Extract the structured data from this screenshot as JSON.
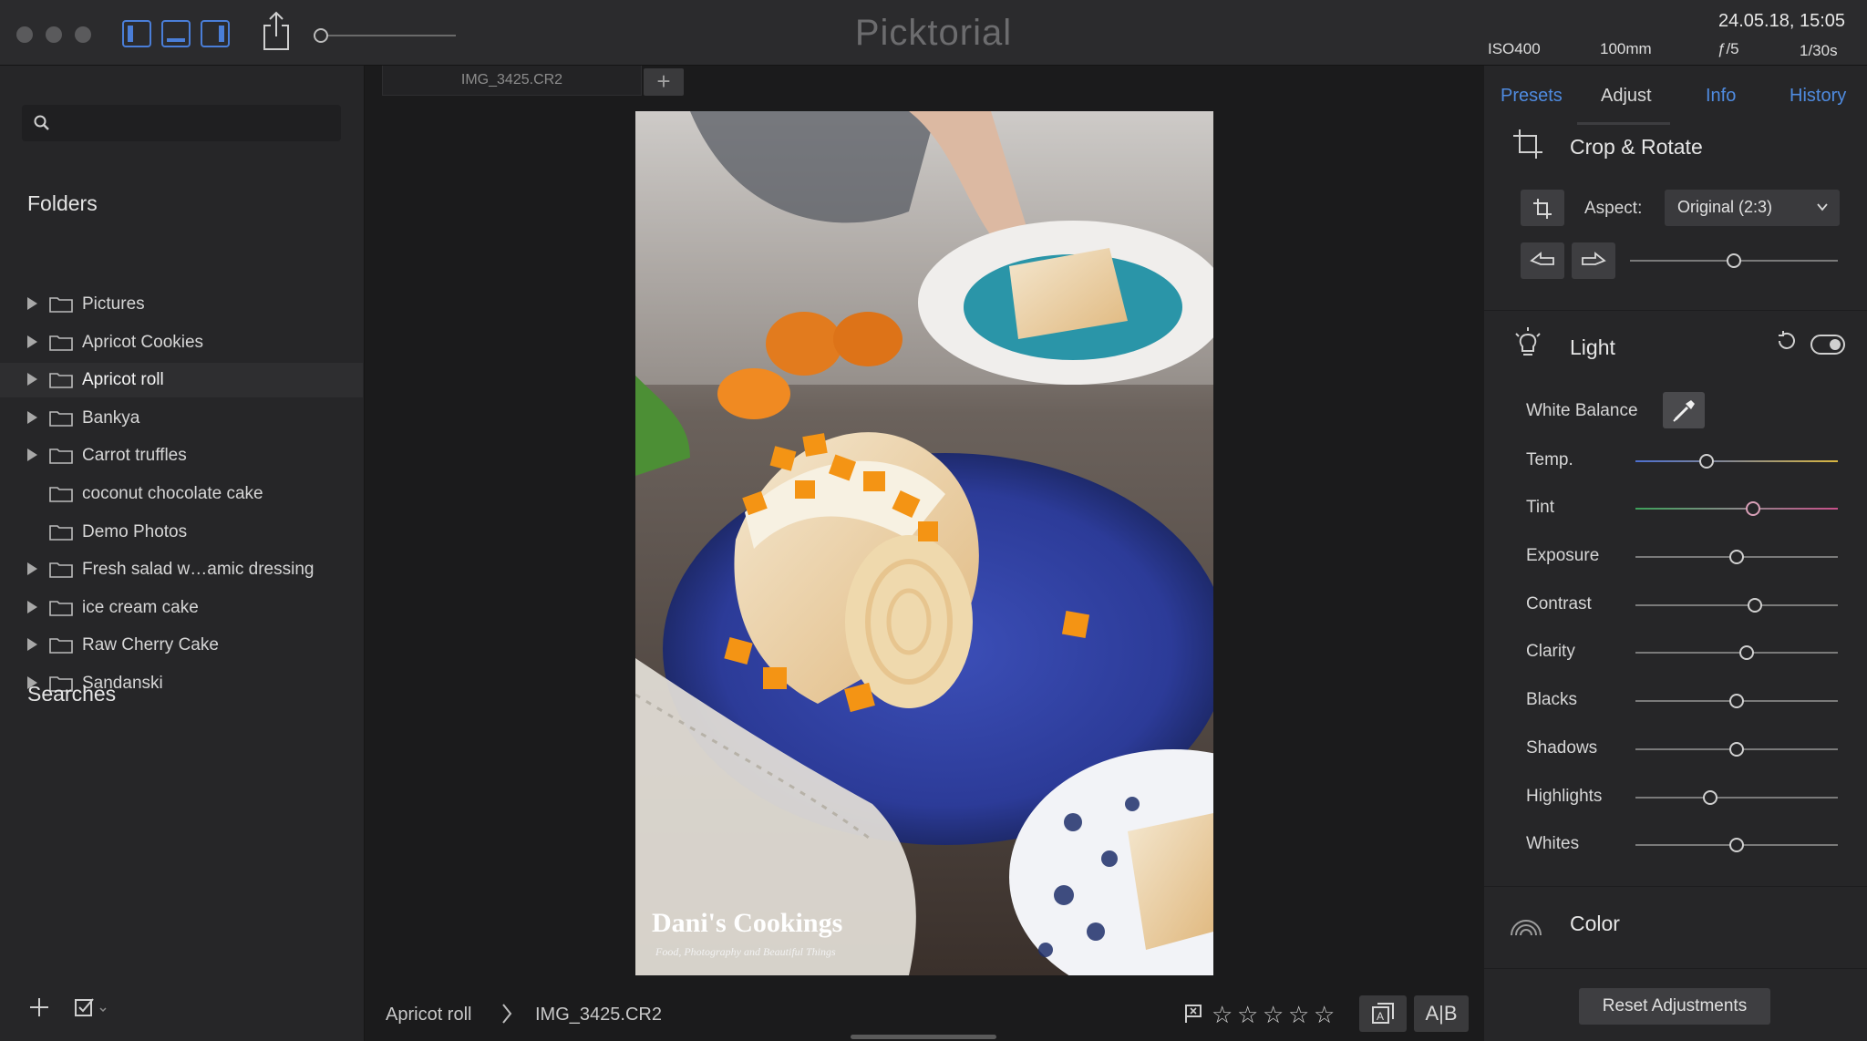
{
  "app": {
    "title": "Picktorial"
  },
  "titlebar": {
    "iso": "ISO400",
    "focal": "100mm",
    "aperture": "ƒ/5",
    "shutter": "1/30s",
    "datetime": "24.05.18, 15:05"
  },
  "sidebar": {
    "search_placeholder": "",
    "folders_title": "Folders",
    "searches_title": "Searches",
    "folders": [
      {
        "label": "Pictures",
        "expandable": true
      },
      {
        "label": "Apricot Cookies",
        "expandable": true
      },
      {
        "label": "Apricot roll",
        "expandable": true,
        "selected": true
      },
      {
        "label": "Bankya",
        "expandable": true
      },
      {
        "label": "Carrot truffles",
        "expandable": true
      },
      {
        "label": "coconut chocolate cake",
        "expandable": false
      },
      {
        "label": "Demo Photos",
        "expandable": false
      },
      {
        "label": "Fresh salad w…amic dressing",
        "expandable": true
      },
      {
        "label": "ice cream cake",
        "expandable": true
      },
      {
        "label": "Raw Cherry Cake",
        "expandable": true
      },
      {
        "label": "Sandanski",
        "expandable": true
      }
    ]
  },
  "viewer": {
    "tab_label": "IMG_3425.CR2",
    "tab_add": "+",
    "watermark_title": "Dani's Cookings",
    "watermark_sub": "Food, Photography and Beautiful Things",
    "breadcrumb": {
      "folder": "Apricot roll",
      "file": "IMG_3425.CR2"
    },
    "rating": {
      "stars": 0,
      "max": 5,
      "star_glyph": "☆"
    },
    "ab_label": "A|B"
  },
  "panel": {
    "tabs": [
      {
        "label": "Presets",
        "active": false
      },
      {
        "label": "Adjust",
        "active": true
      },
      {
        "label": "Info",
        "active": false
      },
      {
        "label": "History",
        "active": false
      }
    ],
    "crop": {
      "title": "Crop & Rotate",
      "aspect_label": "Aspect:",
      "aspect_value": "Original (2:3)",
      "straighten": 0.5
    },
    "light": {
      "title": "Light",
      "white_balance_label": "White Balance",
      "sliders": [
        {
          "label": "Temp.",
          "value": 0.35,
          "track": "temp"
        },
        {
          "label": "Tint",
          "value": 0.58,
          "track": "tint"
        },
        {
          "label": "Exposure",
          "value": 0.5
        },
        {
          "label": "Contrast",
          "value": 0.59
        },
        {
          "label": "Clarity",
          "value": 0.55
        },
        {
          "label": "Blacks",
          "value": 0.5
        },
        {
          "label": "Shadows",
          "value": 0.5
        },
        {
          "label": "Highlights",
          "value": 0.37
        },
        {
          "label": "Whites",
          "value": 0.5
        }
      ]
    },
    "color": {
      "title": "Color"
    },
    "reset_label": "Reset Adjustments"
  }
}
